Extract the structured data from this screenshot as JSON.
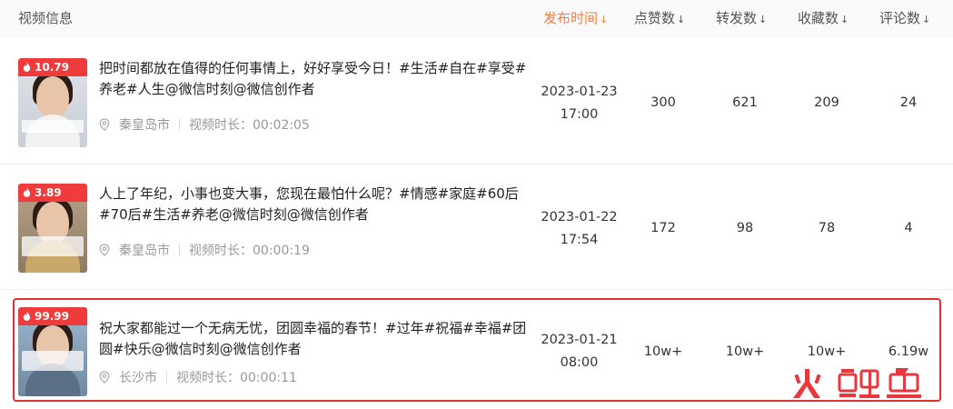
{
  "header": {
    "video_info": "视频信息",
    "publish_time": "发布时间",
    "likes": "点赞数",
    "shares": "转发数",
    "favorites": "收藏数",
    "comments": "评论数",
    "sort_glyph": "↓",
    "active_color": "#ff7a3d"
  },
  "rows": [
    {
      "heat": "10.79",
      "title": "把时间都放在值得的任何事情上，好好享受今日！#生活#自在#享受#养老#人生@微信时刻@微信创作者",
      "location": "秦皇岛市",
      "duration": "视频时长：00:02:05",
      "date": "2023-01-23",
      "time": "17:00",
      "likes": "300",
      "shares": "621",
      "favorites": "209",
      "comments": "24"
    },
    {
      "heat": "3.89",
      "title": "人上了年纪，小事也变大事，您现在最怕什么呢？#情感#家庭#60后#70后#生活#养老@微信时刻@微信创作者",
      "location": "秦皇岛市",
      "duration": "视频时长：00:00:19",
      "date": "2023-01-22",
      "time": "17:54",
      "likes": "172",
      "shares": "98",
      "favorites": "78",
      "comments": "4"
    },
    {
      "heat": "99.99",
      "title": "祝大家都能过一个无病无忧，团圆幸福的春节！#过年#祝福#幸福#团圆#快乐@微信时刻@微信创作者",
      "location": "长沙市",
      "duration": "视频时长：00:00:11",
      "date": "2023-01-21",
      "time": "08:00",
      "likes": "10w+",
      "shares": "10w+",
      "favorites": "10w+",
      "comments": "6.19w"
    }
  ],
  "colors": {
    "badge": "#ef3b3b",
    "highlight_border": "#e23030",
    "logo_red": "#e8383d"
  },
  "watermark": "火鲤鱼"
}
